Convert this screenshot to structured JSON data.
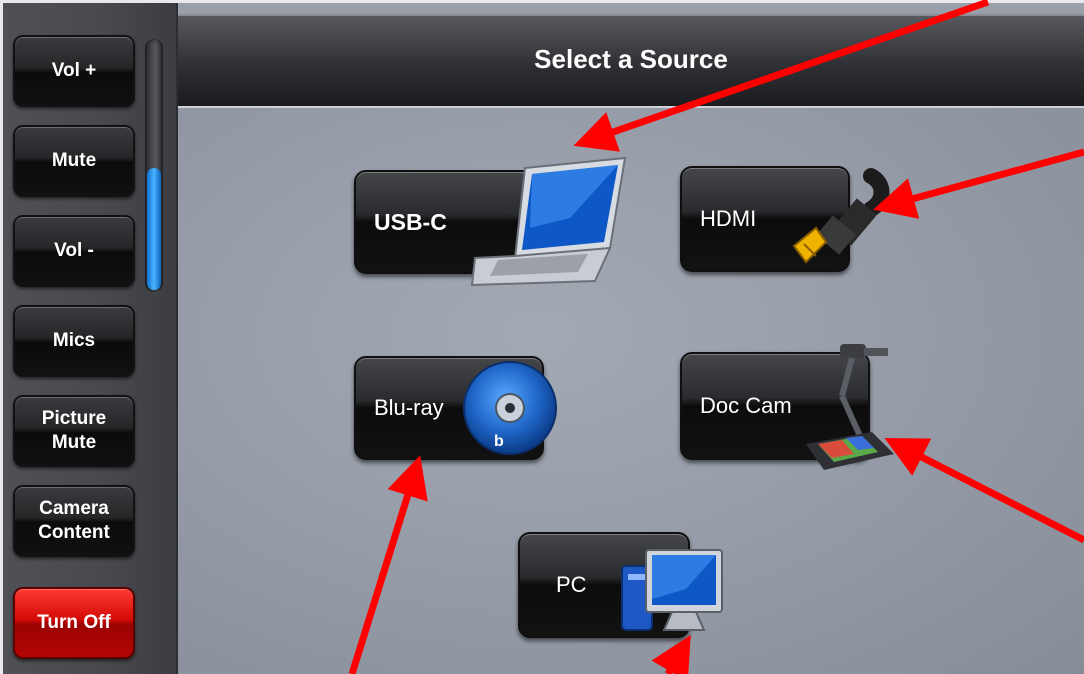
{
  "sidebar": {
    "buttons": [
      {
        "label": "Vol +"
      },
      {
        "label": "Mute"
      },
      {
        "label": "Vol -"
      },
      {
        "label": "Mics"
      },
      {
        "label": "Picture Mute"
      },
      {
        "label": "Camera Content"
      },
      {
        "label": "Turn Off"
      }
    ],
    "volume_level": 0.5
  },
  "header": {
    "title": "Select a Source"
  },
  "sources": [
    {
      "label": "USB-C",
      "icon": "laptop-icon"
    },
    {
      "label": "HDMI",
      "icon": "hdmi-cable-icon"
    },
    {
      "label": "Blu-ray",
      "icon": "bluray-disc-icon"
    },
    {
      "label": "Doc Cam",
      "icon": "document-camera-icon"
    },
    {
      "label": "PC",
      "icon": "desktop-pc-icon"
    }
  ],
  "colors": {
    "arrow": "#ff0000",
    "turn_off": "#d30b07",
    "volume_fill": "#3aa6ff"
  }
}
